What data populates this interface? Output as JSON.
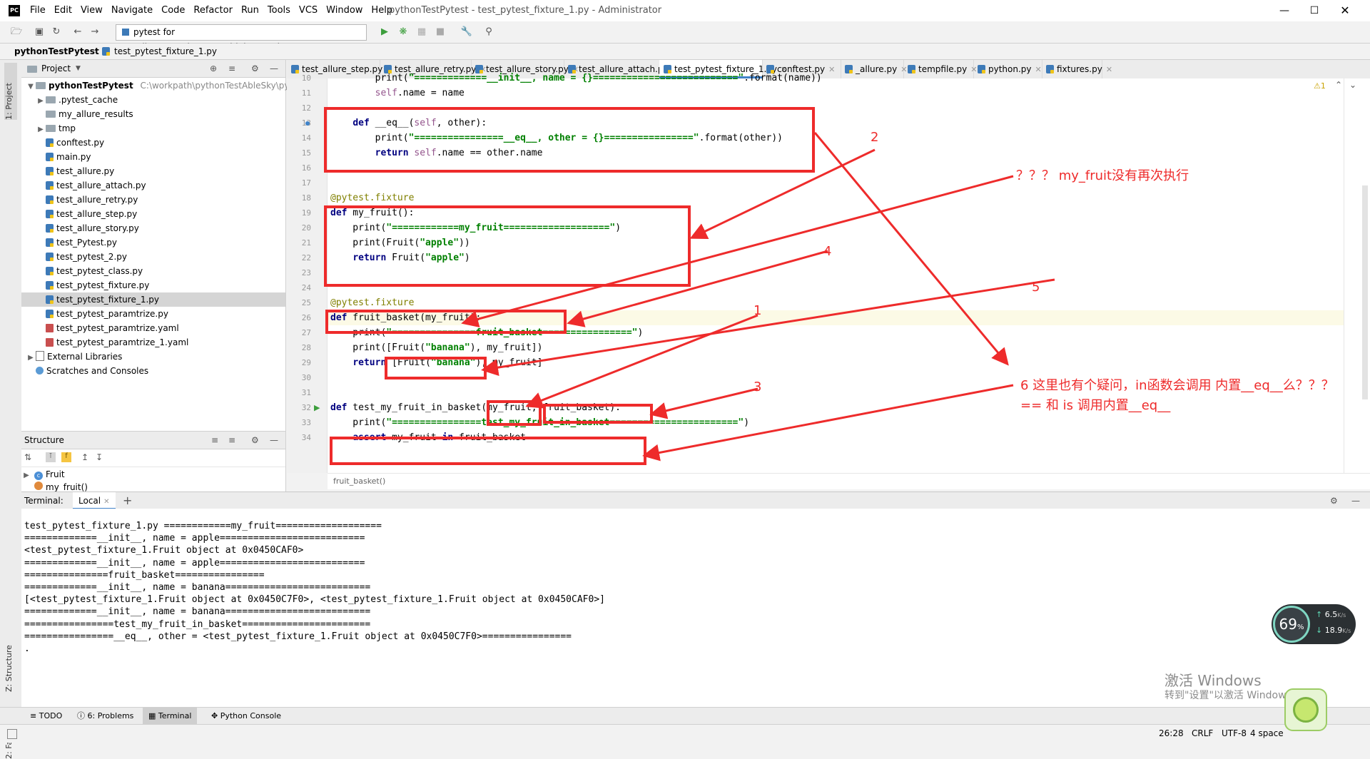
{
  "window": {
    "title": "pythonTestPytest - test_pytest_fixture_1.py - Administrator",
    "menu": [
      "File",
      "Edit",
      "View",
      "Navigate",
      "Code",
      "Refactor",
      "Run",
      "Tools",
      "VCS",
      "Window",
      "Help"
    ]
  },
  "toolbar": {
    "run_config": "pytest for test_allure_attach.test_multiple_attachments"
  },
  "navbar": {
    "project": "pythonTestPytest",
    "file": "test_pytest_fixture_1.py"
  },
  "left_stripe": {
    "project_tab": "1: Project",
    "structure_tab": "Z: Structure",
    "favorites_tab": "2: Favorites"
  },
  "project_panel": {
    "title": "Project",
    "root_name": "pythonTestPytest",
    "root_path": "C:\\workpath\\pythonTestAbleSky\\pyth",
    "items": [
      {
        "label": ".pytest_cache",
        "type": "folder",
        "expandable": true
      },
      {
        "label": "my_allure_results",
        "type": "folder",
        "expandable": false
      },
      {
        "label": "tmp",
        "type": "folder",
        "expandable": true
      },
      {
        "label": "conftest.py",
        "type": "py"
      },
      {
        "label": "main.py",
        "type": "py"
      },
      {
        "label": "test_allure.py",
        "type": "py"
      },
      {
        "label": "test_allure_attach.py",
        "type": "py"
      },
      {
        "label": "test_allure_retry.py",
        "type": "py"
      },
      {
        "label": "test_allure_step.py",
        "type": "py"
      },
      {
        "label": "test_allure_story.py",
        "type": "py"
      },
      {
        "label": "test_Pytest.py",
        "type": "py"
      },
      {
        "label": "test_pytest_2.py",
        "type": "py"
      },
      {
        "label": "test_pytest_class.py",
        "type": "py"
      },
      {
        "label": "test_pytest_fixture.py",
        "type": "py"
      },
      {
        "label": "test_pytest_fixture_1.py",
        "type": "py",
        "selected": true
      },
      {
        "label": "test_pytest_paramtrize.py",
        "type": "py"
      },
      {
        "label": "test_pytest_paramtrize.yaml",
        "type": "yml"
      },
      {
        "label": "test_pytest_paramtrize_1.yaml",
        "type": "yml"
      }
    ],
    "external_libraries": "External Libraries",
    "scratches": "Scratches and Consoles"
  },
  "structure_panel": {
    "title": "Structure",
    "items": [
      "Fruit",
      "my_fruit()"
    ]
  },
  "editor_tabs": [
    {
      "label": "test_allure_step.py"
    },
    {
      "label": "test_allure_retry.py"
    },
    {
      "label": "test_allure_story.py"
    },
    {
      "label": "test_allure_attach.py"
    },
    {
      "label": "test_pytest_fixture_1.py",
      "active": true
    },
    {
      "label": "conftest.py"
    },
    {
      "label": "_allure.py"
    },
    {
      "label": "tempfile.py"
    },
    {
      "label": "python.py"
    },
    {
      "label": "fixtures.py"
    }
  ],
  "editor": {
    "warning_count": "1",
    "line_numbers": [
      "10",
      "11",
      "12",
      "13",
      "14",
      "15",
      "16",
      "17",
      "18",
      "19",
      "20",
      "21",
      "22",
      "23",
      "24",
      "25",
      "26",
      "27",
      "28",
      "29",
      "30",
      "31",
      "32",
      "33",
      "34"
    ],
    "lines": [
      "        print(\"=============__init__, name = {}==========================\".format(name))",
      "        self.name = name",
      "",
      "    def __eq__(self, other):",
      "        print(\"================__eq__, other = {}================\".format(other))",
      "        return self.name == other.name",
      "",
      "",
      "@pytest.fixture",
      "def my_fruit():",
      "    print(\"============my_fruit===================\")",
      "    print(Fruit(\"apple\"))",
      "    return Fruit(\"apple\")",
      "",
      "",
      "@pytest.fixture",
      "def fruit_basket(my_fruit):",
      "    print(\"===============fruit_basket================\")",
      "    print([Fruit(\"banana\"), my_fruit])",
      "    return [Fruit(\"banana\"), my_fruit]",
      "",
      "",
      "def test_my_fruit_in_basket(my_fruit, fruit_basket):",
      "    print(\"================test_my_fruit_in_basket=======================\")",
      "    assert my_fruit in fruit_basket"
    ],
    "breadcrumb": "fruit_basket()"
  },
  "terminal": {
    "label": "Terminal:",
    "tab": "Local",
    "lines": [
      "test_pytest_fixture_1.py ============my_fruit===================",
      "=============__init__, name = apple==========================",
      "<test_pytest_fixture_1.Fruit object at 0x0450CAF0>",
      "=============__init__, name = apple==========================",
      "===============fruit_basket================",
      "=============__init__, name = banana==========================",
      "[<test_pytest_fixture_1.Fruit object at 0x0450C7F0>, <test_pytest_fixture_1.Fruit object at 0x0450CAF0>]",
      "=============__init__, name = banana==========================",
      "================test_my_fruit_in_basket=======================",
      "================__eq__, other = <test_pytest_fixture_1.Fruit object at 0x0450C7F0>================",
      "."
    ]
  },
  "bottom_tabs": [
    "TODO",
    "6: Problems",
    "Terminal",
    "Python Console"
  ],
  "status_bar": {
    "position": "26:28",
    "line_sep": "CRLF",
    "encoding": "UTF-8",
    "indent": "4 space"
  },
  "annotations": {
    "label_1": "1",
    "label_2": "2",
    "label_3": "3",
    "label_4": "4",
    "label_5": "5",
    "question_top": "？？？ my_fruit没有再次执行",
    "question_6a": "6  这里也有个疑问，in函数会调用 内置__eq__么？？？",
    "question_6b": "== 和 is  调用内置__eq__"
  },
  "net_widget": {
    "percent": "69",
    "upload": "6.5",
    "download": "18.9",
    "unit": "K/s"
  },
  "watermark": {
    "line1": "激活 Windows",
    "line2": "转到\"设置\"以激活 Windows。"
  },
  "colors": {
    "annotation": "#ee2b2b",
    "accent": "#4083c9"
  }
}
